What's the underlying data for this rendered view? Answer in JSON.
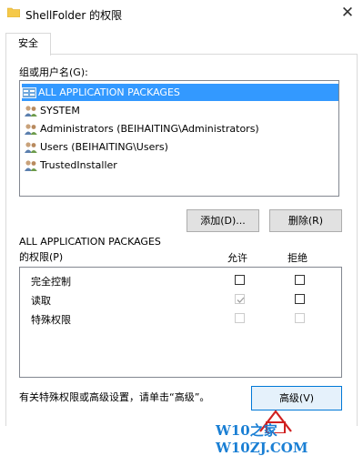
{
  "window": {
    "title": "ShellFolder 的权限",
    "close_glyph": "✕"
  },
  "tabs": [
    {
      "label": "安全"
    }
  ],
  "group_label": "组或用户名(G):",
  "users": [
    {
      "name": "ALL APPLICATION PACKAGES",
      "icon": "app-packages-icon",
      "selected": true
    },
    {
      "name": "SYSTEM",
      "icon": "users-icon",
      "selected": false
    },
    {
      "name": "Administrators (BEIHAITING\\Administrators)",
      "icon": "users-icon",
      "selected": false
    },
    {
      "name": "Users (BEIHAITING\\Users)",
      "icon": "users-icon",
      "selected": false
    },
    {
      "name": "TrustedInstaller",
      "icon": "users-icon",
      "selected": false
    }
  ],
  "buttons": {
    "add": "添加(D)...",
    "remove": "删除(R)",
    "advanced": "高级(V)"
  },
  "permissions": {
    "for_principal": "ALL APPLICATION PACKAGES",
    "label": "的权限(P)",
    "col_allow": "允许",
    "col_deny": "拒绝",
    "rows": [
      {
        "name": "完全控制",
        "allow": false,
        "deny": false,
        "enabled": true
      },
      {
        "name": "读取",
        "allow": true,
        "deny": false,
        "enabled": true
      },
      {
        "name": "特殊权限",
        "allow": false,
        "deny": false,
        "enabled": false
      }
    ]
  },
  "advanced_note": "有关特殊权限或高级设置，请单击“高级”。",
  "watermark": "W10之家 W10ZJ.COM",
  "colors": {
    "selection": "#3399ff",
    "accent": "#0078d7",
    "watermark": "#1a7fd4"
  }
}
